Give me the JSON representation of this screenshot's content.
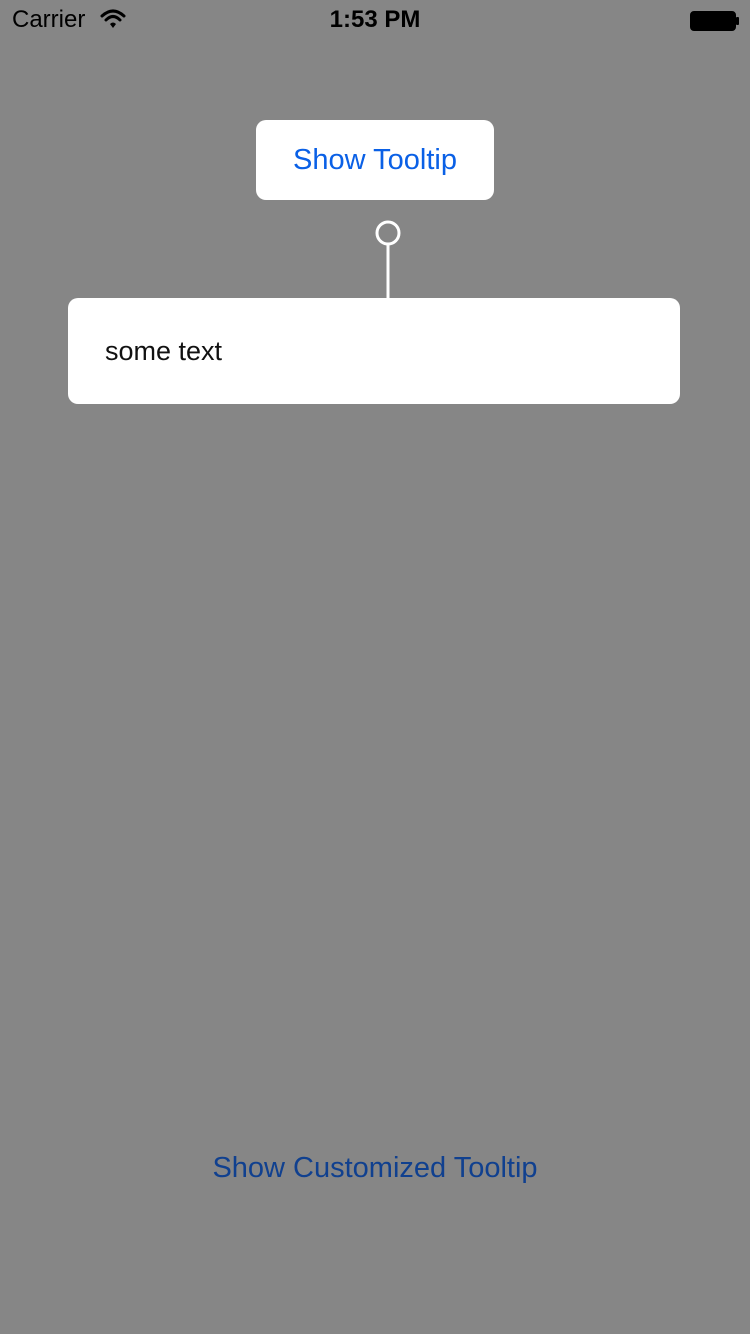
{
  "status_bar": {
    "carrier": "Carrier",
    "time": "1:53 PM",
    "wifi_icon": "wifi-icon",
    "battery_icon": "battery-icon"
  },
  "main": {
    "show_tooltip_label": "Show Tooltip",
    "tooltip_text": "some text",
    "show_customized_tooltip_label": "Show Customized Tooltip",
    "connector_icon": "tooltip-anchor-icon"
  },
  "colors": {
    "background": "#868686",
    "surface": "#ffffff",
    "link_primary": "#0a60e6",
    "link_secondary": "#10408f"
  }
}
